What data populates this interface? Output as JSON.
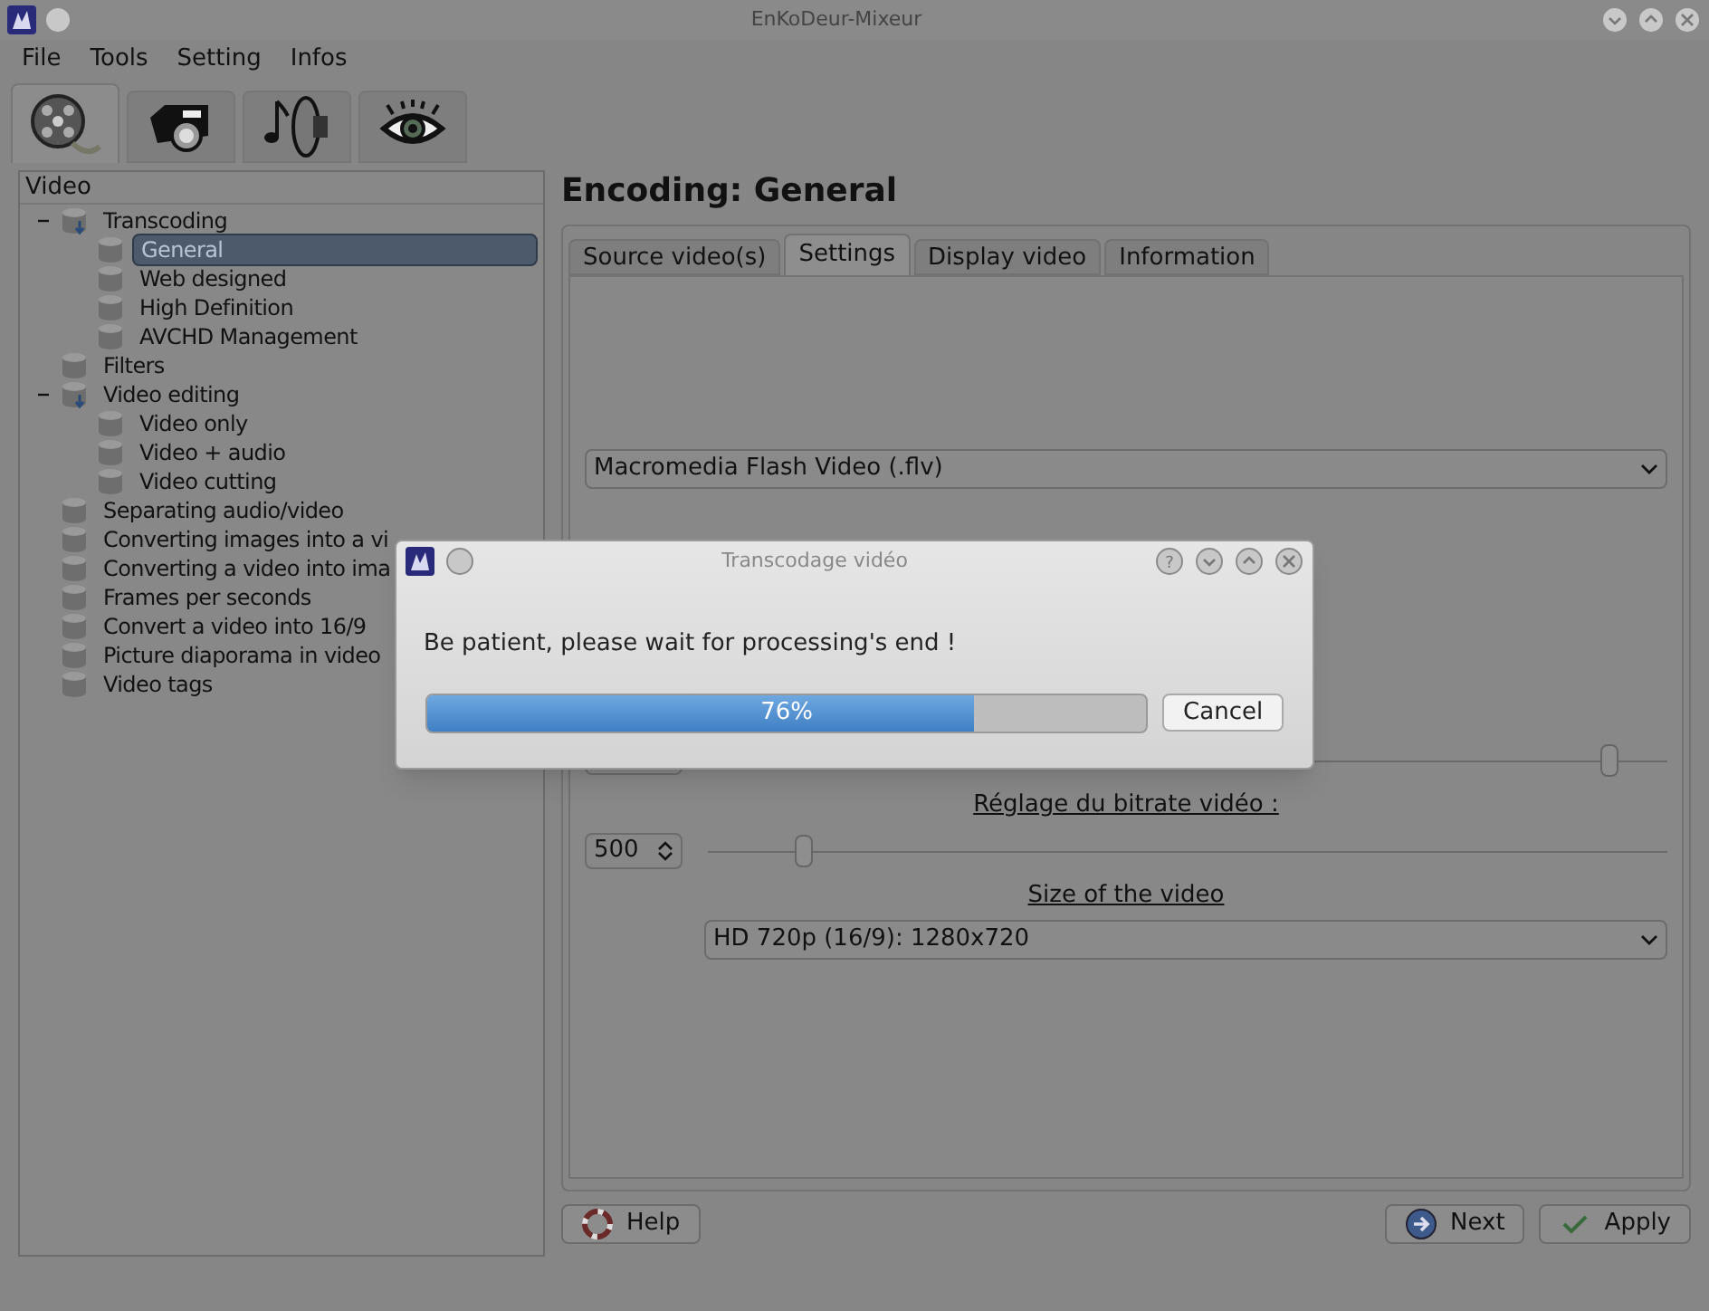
{
  "window": {
    "title": "EnKoDeur-Mixeur"
  },
  "menu": [
    {
      "label": "File"
    },
    {
      "label": "Tools"
    },
    {
      "label": "Setting"
    },
    {
      "label": "Infos"
    }
  ],
  "toolbar_tabs": [
    {
      "kind": "film",
      "selected": true
    },
    {
      "kind": "camera",
      "selected": false
    },
    {
      "kind": "audio",
      "selected": false
    },
    {
      "kind": "eye",
      "selected": false
    }
  ],
  "sidebar": {
    "title": "Video",
    "items": [
      {
        "label": "Transcoding",
        "expanded": true,
        "selected": false,
        "children": [
          {
            "label": "General",
            "selected": true
          },
          {
            "label": "Web designed",
            "selected": false
          },
          {
            "label": "High Definition",
            "selected": false
          },
          {
            "label": "AVCHD Management",
            "selected": false
          }
        ]
      },
      {
        "label": "Filters",
        "selected": false
      },
      {
        "label": "Video editing",
        "expanded": true,
        "selected": false,
        "children": [
          {
            "label": "Video only",
            "selected": false
          },
          {
            "label": "Video + audio",
            "selected": false
          },
          {
            "label": "Video cutting",
            "selected": false
          }
        ]
      },
      {
        "label": "Separating audio/video",
        "selected": false
      },
      {
        "label": "Converting images into a vi",
        "selected": false
      },
      {
        "label": "Converting a video into ima",
        "selected": false
      },
      {
        "label": "Frames per seconds",
        "selected": false
      },
      {
        "label": "Convert a video into 16/9",
        "selected": false
      },
      {
        "label": "Picture diaporama in video",
        "selected": false
      },
      {
        "label": "Video tags",
        "selected": false
      }
    ]
  },
  "content": {
    "title": "Encoding: General",
    "tabs": [
      {
        "label": "Source video(s)",
        "selected": false
      },
      {
        "label": "Settings",
        "selected": true
      },
      {
        "label": "Display video",
        "selected": false
      },
      {
        "label": "Information",
        "selected": false
      }
    ],
    "format_select": {
      "value": "Macromedia Flash Video (.flv)"
    },
    "quality_slider": {
      "level": 0.94
    },
    "bitrate": {
      "label": "Réglage du bitrate vidéo :",
      "value": "500",
      "level": 0.1
    },
    "size": {
      "label": "Size of the video",
      "value": "HD 720p (16/9): 1280x720"
    }
  },
  "buttons": [
    {
      "kind": "help",
      "label": "Help"
    },
    {
      "kind": "next",
      "label": "Next"
    },
    {
      "kind": "apply",
      "label": "Apply"
    }
  ],
  "dialog": {
    "title": "Transcodage vidéo",
    "help_glyph": "?",
    "message": "Be patient, please wait for processing's end !",
    "progress": {
      "level": 0.76,
      "text": "76%"
    },
    "cancel": "Cancel"
  }
}
